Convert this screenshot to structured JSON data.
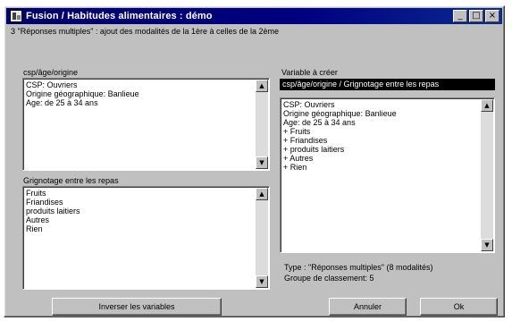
{
  "window": {
    "title": "Fusion / Habitudes alimentaires : démo",
    "minimize_label": "_",
    "maximize_label": "□",
    "close_label": "×"
  },
  "subtitle": "3 \"Réponses multiples\" : ajout des modalités de la 1ère à celles de la 2ème",
  "left_panel": {
    "top_label": "csp/âge/origine",
    "top_lines": [
      "CSP: Ouvriers",
      "Origine géographique: Banlieue",
      "Age: de 25 à 34 ans"
    ],
    "bottom_label": "Grignotage entre les repas",
    "bottom_lines": [
      "Fruits",
      "Friandises",
      "produits laitiers",
      "Autres",
      "Rien"
    ]
  },
  "right_panel": {
    "label": "Variable à créer",
    "selected_name": "csp/âge/origine / Grignotage entre les repas",
    "lines": [
      "CSP: Ouvriers",
      "Origine géographique: Banlieue",
      "Age: de 25 à 34 ans",
      "+ Fruits",
      "+ Friandises",
      "+ produits laitiers",
      "+ Autres",
      "+ Rien"
    ],
    "type_text": "Type : \"Réponses multiples\" (8 modalités)",
    "group_text": "Groupe de classement: 5"
  },
  "buttons": {
    "swap": "Inverser les variables",
    "cancel": "Annuler",
    "ok": "Ok"
  },
  "icons": {
    "scroll_up": "▲",
    "scroll_down": "▼"
  }
}
